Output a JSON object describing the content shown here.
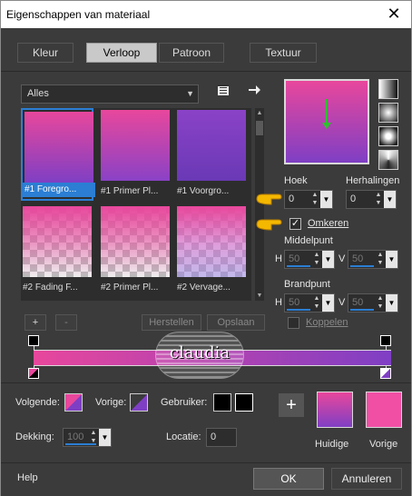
{
  "window": {
    "title": "Eigenschappen van materiaal",
    "close_glyph": "✕"
  },
  "tabs": [
    {
      "label": "Kleur",
      "active": false
    },
    {
      "label": "Verloop",
      "active": true
    },
    {
      "label": "Patroon",
      "active": false
    },
    {
      "label": "Textuur",
      "active": false
    }
  ],
  "library": {
    "category": "Alles",
    "tiles": [
      {
        "caption": "#1 Foregro...",
        "selected": true
      },
      {
        "caption": "#1 Primer Pl...",
        "selected": false
      },
      {
        "caption": "#1 Voorgro...",
        "selected": false
      },
      {
        "caption": "#2 Fading F...",
        "selected": false
      },
      {
        "caption": "#2 Primer Pl...",
        "selected": false
      },
      {
        "caption": "#2 Vervage...",
        "selected": false
      }
    ],
    "add_label": "+",
    "remove_label": "-",
    "restore_label": "Herstellen",
    "save_label": "Opslaan"
  },
  "settings": {
    "hoek_label": "Hoek",
    "hoek_value": "0",
    "herhalingen_label": "Herhalingen",
    "herhalingen_value": "0",
    "omkeren_label": "Omkeren",
    "omkeren_checked": true,
    "middelpunt_label": "Middelpunt",
    "middelpunt_h": "50",
    "middelpunt_v": "50",
    "brandpunt_label": "Brandpunt",
    "brandpunt_h": "50",
    "brandpunt_v": "50",
    "koppelen_label": "Koppelen",
    "koppelen_checked": false,
    "h_label": "H",
    "v_label": "V"
  },
  "editor": {
    "volgende_label": "Volgende:",
    "vorige_label": "Vorige:",
    "gebruiker_label": "Gebruiker:",
    "dekking_label": "Dekking:",
    "dekking_value": "100",
    "locatie_label": "Locatie:",
    "locatie_value": "0",
    "add_stop_label": "+"
  },
  "swatches": {
    "huidige_label": "Huidige",
    "vorige_label": "Vorige"
  },
  "watermark": {
    "text": "claudia"
  },
  "footer": {
    "help_label": "Help",
    "ok_label": "OK",
    "cancel_label": "Annuleren"
  },
  "colors": {
    "pink": "#e8479c",
    "purple": "#7f3fc4",
    "accent": "#2b7ed3",
    "arrow": "#2fbf2f",
    "hand": "#f5b800"
  }
}
